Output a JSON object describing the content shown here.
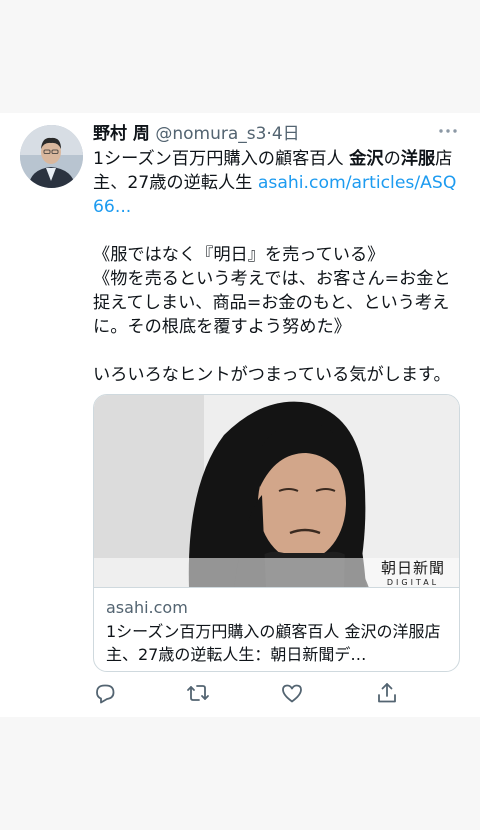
{
  "tweet": {
    "display_name": "野村 周",
    "handle": "@nomura_s3",
    "separator": "·",
    "time": "4日",
    "text_part1": "1シーズン百万円購入の顧客百人 ",
    "text_bold1": "金沢",
    "text_part2": "の",
    "text_bold2": "洋服",
    "text_part3": "店主、27歳の逆転人生 ",
    "link_text": "asahi.com/articles/ASQ66...",
    "text_rest": "\n\n《服ではなく『明日』を売っている》\n《物を売るという考えでは、お客さん=お金と捉えてしまい、商品=お金のもと、という考えに。その根底を覆すよう努めた》\n\nいろいろなヒントがつまっている気がします。"
  },
  "card": {
    "logo_main": "朝日新聞",
    "logo_sub": "DIGITAL",
    "domain": "asahi.com",
    "title": "1シーズン百万円購入の顧客百人 金沢の洋服店主、27歳の逆転人生：朝日新聞デ…"
  },
  "icons": {
    "more": "more-horizontal-icon",
    "reply": "reply-icon",
    "retweet": "retweet-icon",
    "like": "like-icon",
    "share": "share-icon"
  },
  "colors": {
    "link": "#1d9bf0",
    "secondary_text": "#536471",
    "icon": "#536471",
    "border": "#cfd9de"
  }
}
